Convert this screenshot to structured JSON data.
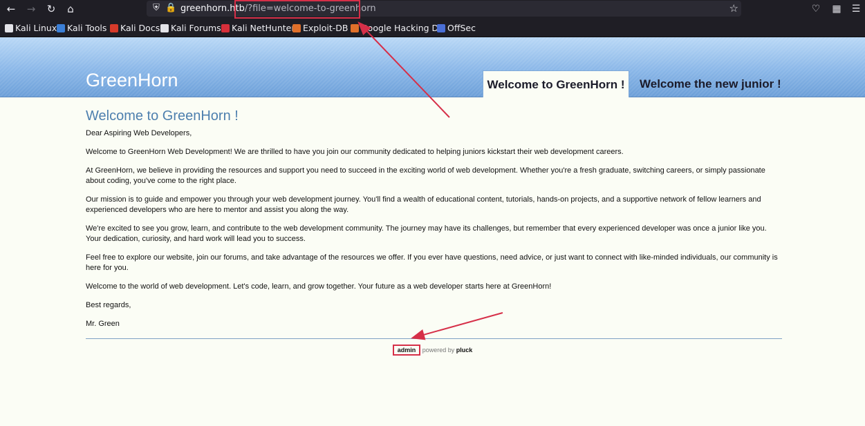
{
  "browser": {
    "url_host": "greenhorn.htb",
    "url_path": "/?file=welcome-to-greenhorn",
    "icons": [
      "back-icon",
      "forward-icon",
      "reload-icon",
      "home-icon",
      "shield-icon",
      "lock-icon",
      "star-icon",
      "pocket-icon",
      "extensions-icon",
      "menu-icon"
    ]
  },
  "bookmarks": [
    {
      "label": "Kali Linux",
      "color": "#e3e3e8"
    },
    {
      "label": "Kali Tools",
      "color": "#3b7fd6"
    },
    {
      "label": "Kali Docs",
      "color": "#d63a2a"
    },
    {
      "label": "Kali Forums",
      "color": "#e3e3e8"
    },
    {
      "label": "Kali NetHunter",
      "color": "#d62f3a"
    },
    {
      "label": "Exploit-DB",
      "color": "#e0702a"
    },
    {
      "label": "Google Hacking DB",
      "color": "#e0702a"
    },
    {
      "label": "OffSec",
      "color": "#4a6fd6"
    }
  ],
  "site": {
    "title": "GreenHorn",
    "tabs": [
      {
        "label": "Welcome to GreenHorn !",
        "active": true
      },
      {
        "label": "Welcome the new junior !",
        "active": false
      }
    ]
  },
  "content": {
    "heading": "Welcome to GreenHorn !",
    "paragraphs": [
      "Dear Aspiring Web Developers,",
      "Welcome to GreenHorn Web Development! We are thrilled to have you join our community dedicated to helping juniors kickstart their web development careers.",
      "At GreenHorn, we believe in providing the resources and support you need to succeed in the exciting world of web development. Whether you're a fresh graduate, switching careers, or simply passionate about coding, you've come to the right place.",
      "Our mission is to guide and empower you through your web development journey. You'll find a wealth of educational content, tutorials, hands-on projects, and a supportive network of fellow learners and experienced developers who are here to mentor and assist you along the way.",
      "We're excited to see you grow, learn, and contribute to the web development community. The journey may have its challenges, but remember that every experienced developer was once a junior like you. Your dedication, curiosity, and hard work will lead you to success.",
      "Feel free to explore our website, join our forums, and take advantage of the resources we offer. If you ever have questions, need advice, or just want to connect with like-minded individuals, our community is here for you.",
      "Welcome to the world of web development. Let's code, learn, and grow together. Your future as a web developer starts here at GreenHorn!",
      "Best regards,",
      "Mr. Green"
    ]
  },
  "footer": {
    "admin": "admin",
    "powered_by": "powered by",
    "pluck": "pluck"
  },
  "annotation_color": "#d62f48"
}
